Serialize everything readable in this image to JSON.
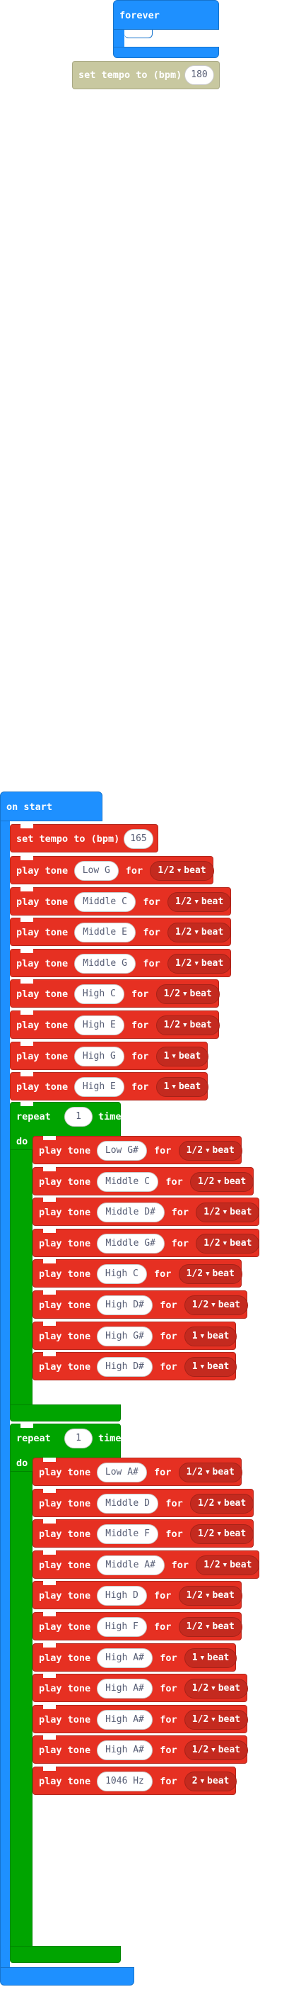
{
  "forever_block": {
    "label": "forever"
  },
  "ghost_tempo": {
    "label": "set tempo to (bpm)",
    "value": "180"
  },
  "on_start": {
    "label": "on start",
    "tempo": {
      "label": "set tempo to (bpm)",
      "value": "165"
    },
    "tones_a": [
      {
        "note": "Low G",
        "beat": "1/2"
      },
      {
        "note": "Middle C",
        "beat": "1/2"
      },
      {
        "note": "Middle E",
        "beat": "1/2"
      },
      {
        "note": "Middle G",
        "beat": "1/2"
      },
      {
        "note": "High C",
        "beat": "1/2"
      },
      {
        "note": "High E",
        "beat": "1/2"
      },
      {
        "note": "High G",
        "beat": "1"
      },
      {
        "note": "High E",
        "beat": "1"
      }
    ],
    "repeat1": {
      "label": "repeat",
      "times": "1",
      "times_label": "times",
      "do": "do",
      "tones": [
        {
          "note": "Low G#",
          "beat": "1/2"
        },
        {
          "note": "Middle C",
          "beat": "1/2"
        },
        {
          "note": "Middle D#",
          "beat": "1/2"
        },
        {
          "note": "Middle G#",
          "beat": "1/2"
        },
        {
          "note": "High C",
          "beat": "1/2"
        },
        {
          "note": "High D#",
          "beat": "1/2"
        },
        {
          "note": "High G#",
          "beat": "1"
        },
        {
          "note": "High D#",
          "beat": "1"
        }
      ]
    },
    "repeat2": {
      "label": "repeat",
      "times": "1",
      "times_label": "times",
      "do": "do",
      "tones": [
        {
          "note": "Low A#",
          "beat": "1/2"
        },
        {
          "note": "Middle D",
          "beat": "1/2"
        },
        {
          "note": "Middle F",
          "beat": "1/2"
        },
        {
          "note": "Middle A#",
          "beat": "1/2"
        },
        {
          "note": "High D",
          "beat": "1/2"
        },
        {
          "note": "High F",
          "beat": "1/2"
        },
        {
          "note": "High A#",
          "beat": "1"
        },
        {
          "note": "High A#",
          "beat": "1/2"
        },
        {
          "note": "High A#",
          "beat": "1/2"
        },
        {
          "note": "High A#",
          "beat": "1/2"
        },
        {
          "note": "1046 Hz",
          "beat": "2"
        }
      ]
    }
  },
  "words": {
    "play_tone": "play tone",
    "for": "for",
    "beat": "beat"
  },
  "colors": {
    "event_blue": "#1e90ff",
    "music_red": "#e63022",
    "loop_green": "#00a400",
    "ghost_olive": "#c8c8a0"
  }
}
